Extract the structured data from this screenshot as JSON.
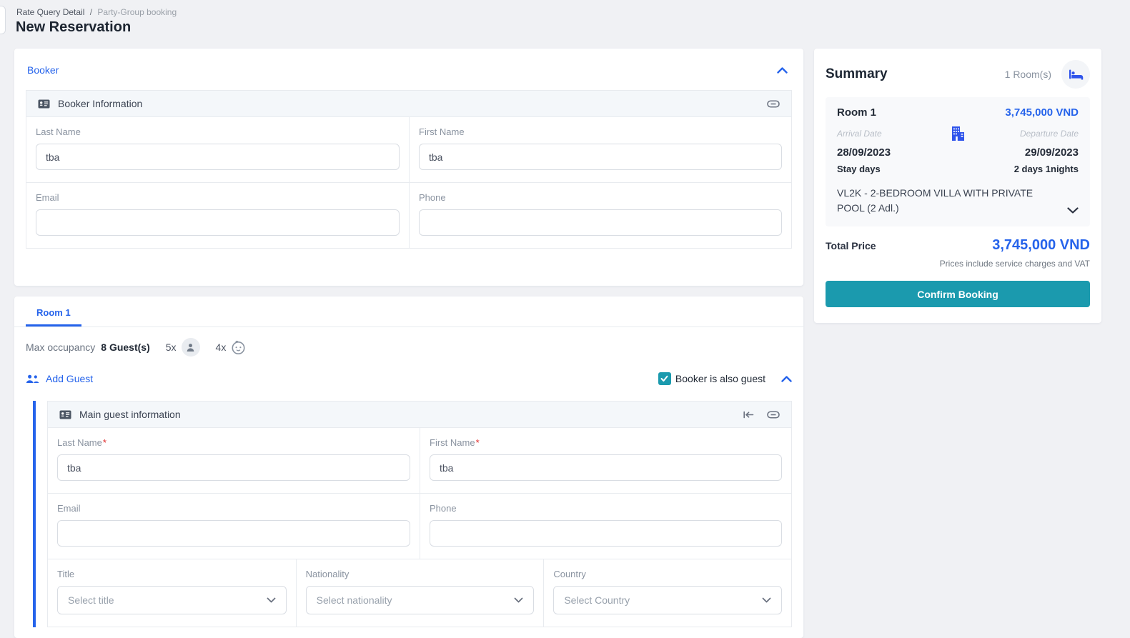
{
  "page": {
    "breadcrumb": {
      "primary": "Rate Query Detail",
      "separator": "/",
      "secondary": "Party-Group booking"
    },
    "title": "New Reservation"
  },
  "booker": {
    "title": "Booker",
    "panel_title": "Booker Information",
    "fields": [
      {
        "label": "Last Name",
        "value": "tba"
      },
      {
        "label": "First Name",
        "value": "tba"
      },
      {
        "label": "Email",
        "value": ""
      },
      {
        "label": "Phone",
        "value": ""
      }
    ]
  },
  "rooms": {
    "tab_label": "Room 1",
    "max_occupancy_label": "Max occupancy",
    "max_occupancy_value": "8 Guest(s)",
    "adult_count": "5x",
    "child_count": "4x",
    "add_guest_label": "Add Guest",
    "booker_is_guest_label": "Booker is also guest",
    "booker_is_guest_checked": true,
    "guest_panel": {
      "title": "Main guest information",
      "fields": [
        {
          "label": "Last Name",
          "required_mark": "*",
          "value": "tba"
        },
        {
          "label": "First Name",
          "required_mark": "*",
          "value": "tba"
        },
        {
          "label": "Email",
          "required_mark": "",
          "value": ""
        },
        {
          "label": "Phone",
          "required_mark": "",
          "value": ""
        }
      ],
      "selects": [
        {
          "label": "Title",
          "placeholder": "Select title"
        },
        {
          "label": "Nationality",
          "placeholder": "Select nationality"
        },
        {
          "label": "Country",
          "placeholder": "Select Country"
        }
      ]
    }
  },
  "summary": {
    "title": "Summary",
    "room_count": "1 Room(s)",
    "room": {
      "name": "Room 1",
      "price": "3,745,000 VND",
      "arrival_label": "Arrival Date",
      "departure_label": "Departure Date",
      "arrival_date": "28/09/2023",
      "departure_date": "29/09/2023",
      "stay_days_label": "Stay days",
      "stay_days_value": "2 days 1nights",
      "room_type": "VL2K - 2-BEDROOM VILLA WITH PRIVATE POOL (2 Adl.)"
    },
    "total_price_label": "Total Price",
    "total_price": "3,745,000 VND",
    "price_note": "Prices include service charges and VAT",
    "confirm_label": "Confirm Booking"
  },
  "icons": {
    "bed-icon": "bed in circle",
    "building-icon": "office building",
    "id-card-icon": "contact card",
    "link-icon": "chain link",
    "chevron-up-icon": "collapse",
    "chevron-down-icon": "expand",
    "adult-icon": "person silhouette",
    "child-icon": "child face outline",
    "people-icon": "two persons",
    "merge-arrows-icon": "arrow to bar",
    "check-icon": "checkmark"
  },
  "colors": {
    "accent_blue": "#2563eb",
    "icon_blue": "#2f54eb",
    "teal": "#1b9aae",
    "required_red": "#e02b2b"
  }
}
